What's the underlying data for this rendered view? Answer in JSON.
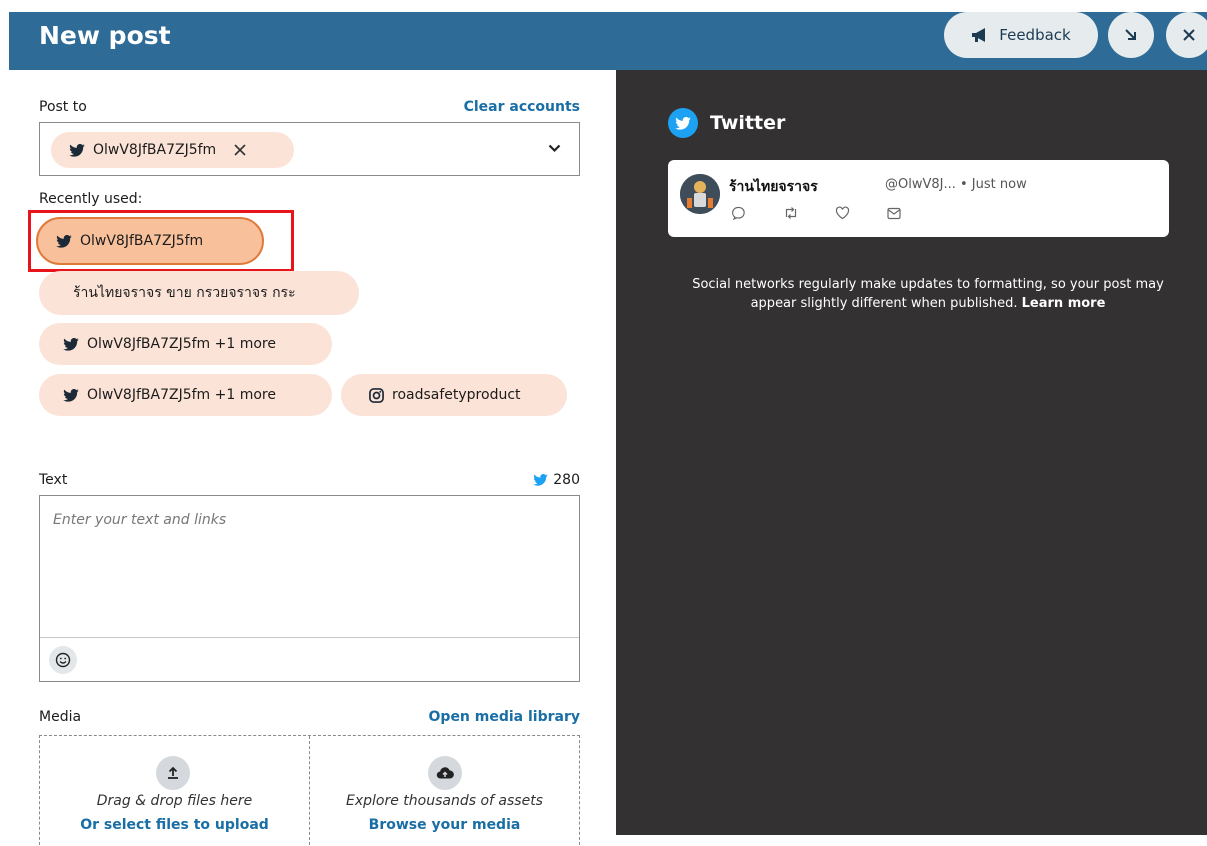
{
  "header": {
    "title": "New post",
    "feedback_label": "Feedback",
    "minimize_icon": "arrow-down-right-icon",
    "close_icon": "close-icon"
  },
  "post_to": {
    "label": "Post to",
    "clear_label": "Clear accounts",
    "selected_account": "OlwV8JfBA7ZJ5fm",
    "remove_icon": "close-icon",
    "dropdown_icon": "chevron-down-icon"
  },
  "recently_used": {
    "label": "Recently used:",
    "items": [
      {
        "label": "OlwV8JfBA7ZJ5fm",
        "icon": "twitter-icon"
      },
      {
        "label": "ร้านไทยจราจร ขาย กรวยจราจร กระ",
        "icon": ""
      },
      {
        "label": "OlwV8JfBA7ZJ5fm +1 more",
        "icon": "twitter-icon"
      },
      {
        "label": "OlwV8JfBA7ZJ5fm +1 more",
        "icon": "twitter-icon"
      },
      {
        "label": "roadsafetyproduct",
        "icon": "instagram-icon"
      }
    ]
  },
  "text": {
    "label": "Text",
    "char_count": "280",
    "placeholder": "Enter your text and links",
    "emoji_icon": "smiley-icon"
  },
  "media": {
    "label": "Media",
    "library_label": "Open media library",
    "upload_text": "Drag & drop files here",
    "upload_link": "Or select files to upload",
    "explore_text": "Explore thousands of assets",
    "explore_link": "Browse your media"
  },
  "preview": {
    "network": "Twitter",
    "display_name": "ร้านไทยจราจร",
    "handle": "@OlwV8J... • Just now",
    "note": "Social networks regularly make updates to formatting, so your post may appear slightly different when published.",
    "learn_more": "Learn more"
  },
  "colors": {
    "header": "#2e6b96",
    "chip": "#fbe3d7",
    "chip_active": "#f8c09b",
    "link": "#1a6ea6",
    "preview_bg": "#333131",
    "twitter": "#1da1f2",
    "highlight": "#e8141b"
  }
}
